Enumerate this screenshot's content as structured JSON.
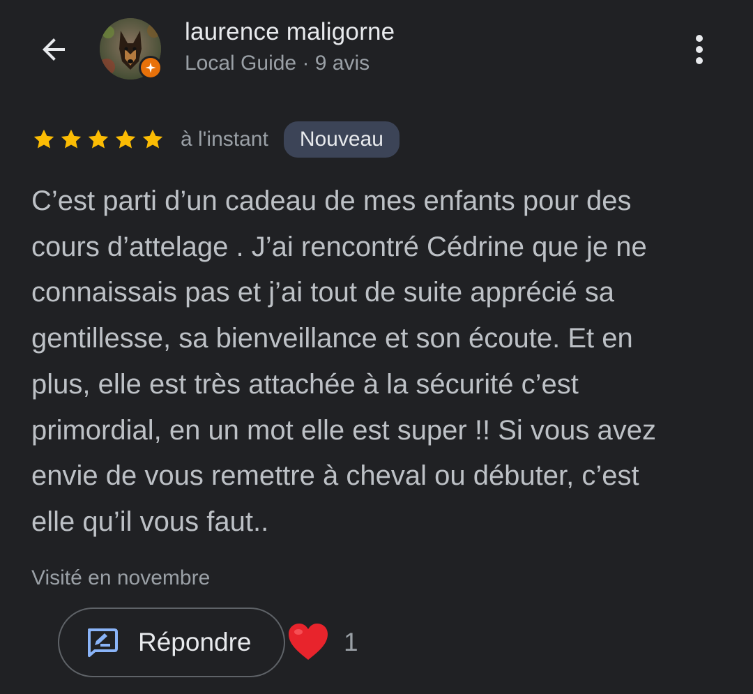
{
  "header": {
    "back_icon": "arrow-back-icon",
    "user_name": "laurence maligorne",
    "user_meta": "Local Guide · 9 avis",
    "more_icon": "more-vert-icon"
  },
  "review": {
    "rating": 5,
    "rating_max": 5,
    "time": "à l'instant",
    "badge": "Nouveau",
    "text": "C’est parti d’un cadeau de mes enfants pour des\ncours d’attelage . J’ai rencontré Cédrine que je ne\nconnaissais pas et j’ai tout de suite apprécié sa\ngentillesse, sa bienveillance et son écoute. Et en\nplus, elle est très attachée à la sécurité c’est\nprimordial, en un mot elle est super !! Si vous avez\nenvie de vous remettre à cheval ou débuter, c’est\nelle qu’il vous faut..",
    "visited": "Visité en novembre"
  },
  "actions": {
    "reply_label": "Répondre",
    "reply_icon": "rate-review-icon",
    "like_icon": "heart-icon",
    "like_count": "1"
  },
  "colors": {
    "background": "#202124",
    "star": "#fbbc04",
    "badge_bg": "#3c4457",
    "reply_icon": "#8ab4f8",
    "heart": "#e8242c",
    "guide_badge": "#e8710a"
  }
}
